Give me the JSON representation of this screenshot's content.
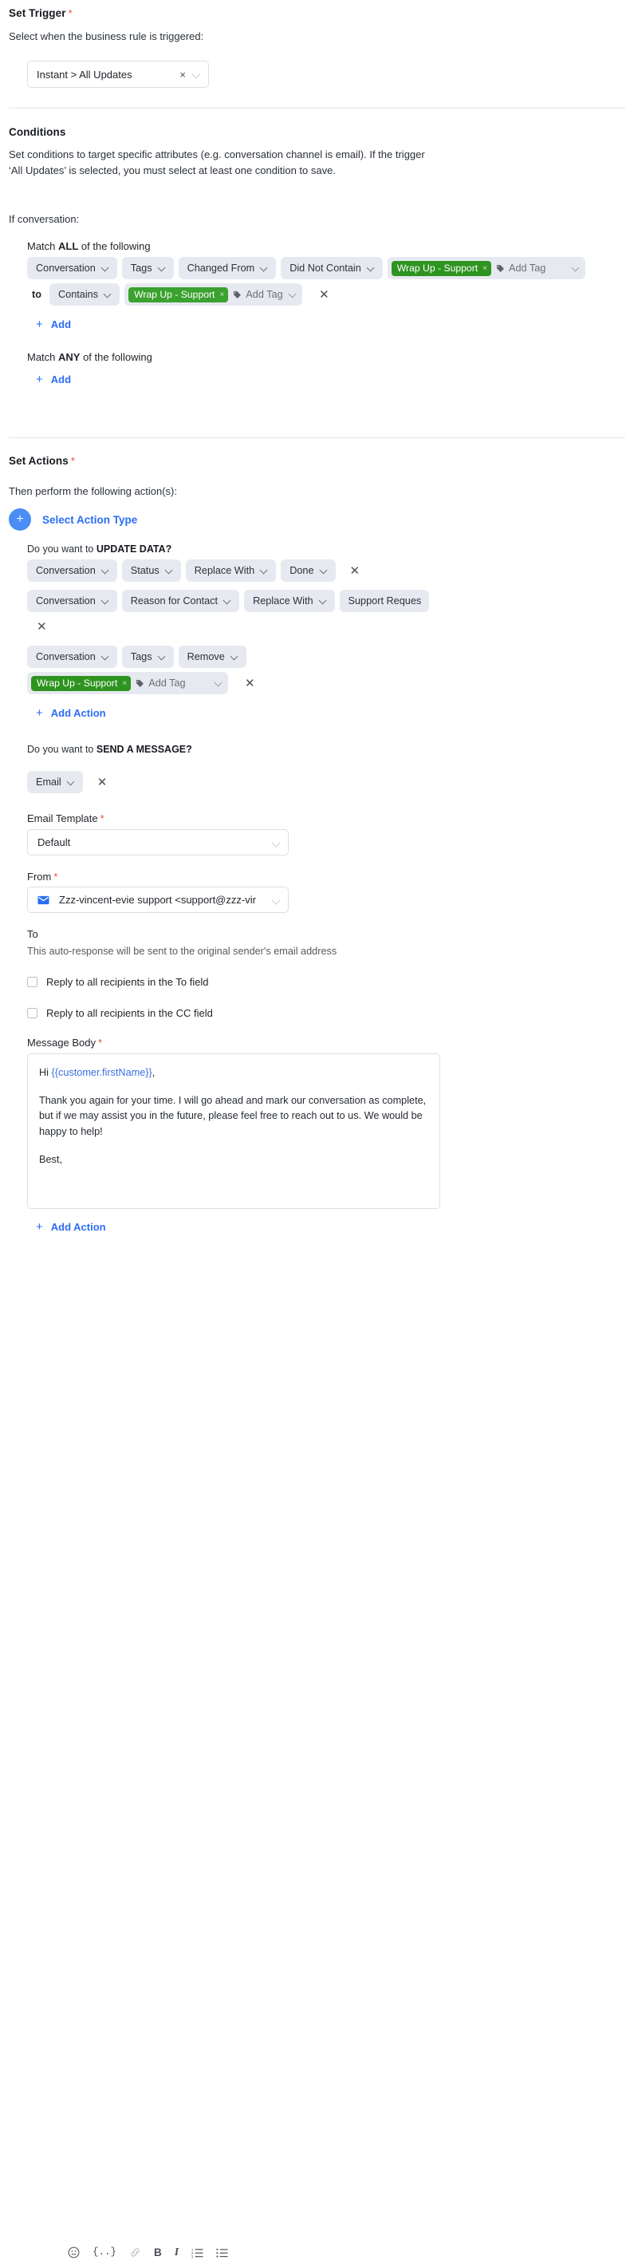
{
  "trigger": {
    "title": "Set Trigger",
    "required_mark": "*",
    "description": "Select when the business rule is triggered:",
    "select_value": "Instant > All Updates",
    "clear_icon": "×"
  },
  "conditions": {
    "title": "Conditions",
    "description": "Set conditions to target specific attributes (e.g. conversation channel is email). If the trigger ‘All Updates’ is selected, you must select at least one condition to save.",
    "if_label": "If conversation:",
    "match_all": {
      "prefix": "Match ",
      "bold": "ALL",
      "suffix": " of the following"
    },
    "match_any": {
      "prefix": "Match ",
      "bold": "ANY",
      "suffix": " of the following"
    },
    "all_rows": [
      {
        "object": "Conversation",
        "attribute": "Tags",
        "event": "Changed From",
        "operator": "Did Not Contain",
        "tags": [
          "Wrap Up - Support"
        ],
        "add_tag_placeholder": "Add Tag"
      },
      {
        "to_label": "to",
        "operator": "Contains",
        "tags": [
          "Wrap Up - Support"
        ],
        "add_tag_placeholder": "Add Tag"
      }
    ],
    "add_all_label": "Add",
    "add_any_label": "Add",
    "plus": "+"
  },
  "actions": {
    "title": "Set Actions",
    "required_mark": "*",
    "description": "Then perform the following action(s):",
    "select_action_type": "Select Action Type",
    "plus": "+",
    "update_data": {
      "prompt_prefix": "Do you want to ",
      "prompt_bold": "UPDATE DATA?",
      "rows": [
        {
          "object": "Conversation",
          "attribute": "Status",
          "operation": "Replace With",
          "value": "Done"
        },
        {
          "object": "Conversation",
          "attribute": "Reason for Contact",
          "operation": "Replace With",
          "value": "Support Reques"
        },
        {
          "object": "Conversation",
          "attribute": "Tags",
          "operation": "Remove",
          "tags": [
            "Wrap Up - Support"
          ],
          "add_tag_placeholder": "Add Tag"
        }
      ],
      "add_action_label": "Add Action"
    },
    "send_message": {
      "prompt_prefix": "Do you want to ",
      "prompt_bold": "SEND A MESSAGE?",
      "channel": "Email",
      "email_template_label": "Email Template",
      "email_template_value": "Default",
      "from_label": "From",
      "from_value": "Zzz-vincent-evie support <support@zzz-vir",
      "to_label": "To",
      "to_note": "This auto-response will be sent to the original sender's email address",
      "checkbox_to": "Reply to all recipients in the To field",
      "checkbox_cc": "Reply to all recipients in the CC field",
      "message_body_label": "Message Body",
      "body": {
        "greeting_prefix": "Hi ",
        "greeting_variable": "{{customer.firstName}}",
        "greeting_suffix": ",",
        "paragraph": "Thank you again for your time. I will go ahead and mark our conversation as complete, but if we may assist you in the future, please feel free to reach out to us. We would be happy to help!",
        "closing": "Best,"
      },
      "toolbar": {
        "emoji": "☺",
        "variable": "{..}",
        "link": "🔗",
        "bold": "B",
        "italic": "I",
        "ordered_list": "ol",
        "bullet_list": "ul"
      },
      "add_action_label": "Add Action"
    }
  },
  "colors": {
    "accent_blue": "#2b6df5",
    "tag_green": "#3ba12f",
    "tag_green_dark": "#2e9420",
    "required_red": "#e8503a",
    "pill_bg": "#e7e9f0"
  }
}
